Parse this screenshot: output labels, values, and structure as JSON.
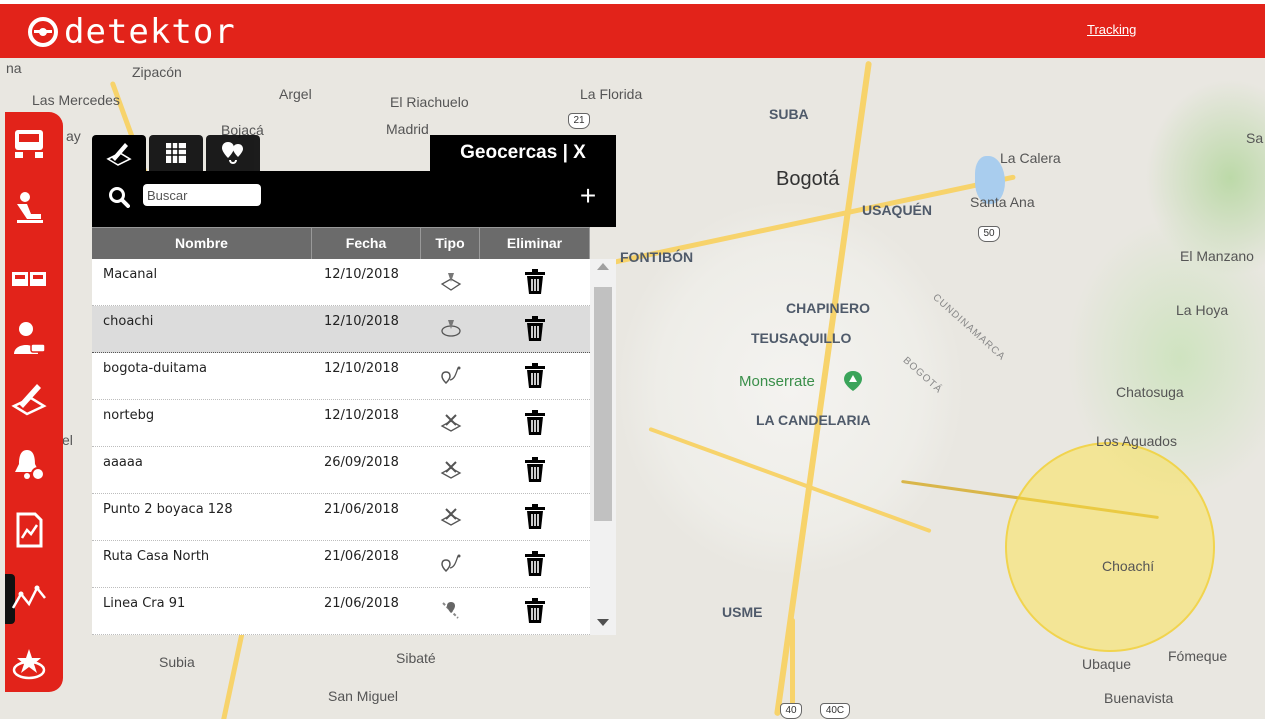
{
  "header": {
    "brand": "detektor",
    "tracking_link": "Tracking",
    "background_color": "#e2231a"
  },
  "map": {
    "labels": [
      {
        "text": "Zipacón"
      },
      {
        "text": "Las Mercedes"
      },
      {
        "text": "Argel"
      },
      {
        "text": "El Riachuelo"
      },
      {
        "text": "Madrid"
      },
      {
        "text": "Bojacá"
      },
      {
        "text": "La Florida"
      },
      {
        "text": "SUBA"
      },
      {
        "text": "Bogotá"
      },
      {
        "text": "USAQUÉN"
      },
      {
        "text": "La Calera"
      },
      {
        "text": "Santa Ana"
      },
      {
        "text": "FONTIBÓN"
      },
      {
        "text": "El Manzano"
      },
      {
        "text": "CHAPINERO"
      },
      {
        "text": "TEUSAQUILLO"
      },
      {
        "text": "La Hoya"
      },
      {
        "text": "Monserrate"
      },
      {
        "text": "LA CANDELARIA"
      },
      {
        "text": "Chatosuga"
      },
      {
        "text": "Los Aguados"
      },
      {
        "text": "Choachí"
      },
      {
        "text": "USME"
      },
      {
        "text": "Subia"
      },
      {
        "text": "Sibaté"
      },
      {
        "text": "San Miguel"
      },
      {
        "text": "Ubaque"
      },
      {
        "text": "Fómeque"
      },
      {
        "text": "Buenavista"
      },
      {
        "text": "CUNDINAMARCA"
      },
      {
        "text": "BOGOTÁ"
      },
      {
        "text": "Sa"
      },
      {
        "text": "na"
      },
      {
        "text": "ay"
      },
      {
        "text": "el"
      }
    ],
    "shields": [
      "21",
      "50",
      "40",
      "40C"
    ],
    "geofence_color": "#ffe23c"
  },
  "sidebar": {
    "items": [
      {
        "name": "truck-icon"
      },
      {
        "name": "driver-icon"
      },
      {
        "name": "fleet-icon"
      },
      {
        "name": "user-car-icon"
      },
      {
        "name": "draw-geofence-icon"
      },
      {
        "name": "alert-bell-icon"
      },
      {
        "name": "report-icon"
      },
      {
        "name": "route-icon"
      },
      {
        "name": "favorite-place-icon"
      }
    ],
    "active_index": 7
  },
  "panel": {
    "title": "Geocercas | X",
    "tabs": [
      {
        "name": "geofence-tab-icon"
      },
      {
        "name": "map-grid-tab-icon"
      },
      {
        "name": "poi-tab-icon"
      }
    ],
    "search": {
      "placeholder": "Buscar",
      "value": ""
    },
    "add_label": "+",
    "columns": [
      "Nombre",
      "Fecha",
      "Tipo",
      "Eliminar"
    ],
    "rows": [
      {
        "name": "Macanal",
        "date": "12/10/2018",
        "type": "polygon",
        "selected": false
      },
      {
        "name": "choachi",
        "date": "12/10/2018",
        "type": "circle",
        "selected": true
      },
      {
        "name": "bogota-duitama",
        "date": "12/10/2018",
        "type": "route",
        "selected": false
      },
      {
        "name": "nortebg",
        "date": "12/10/2018",
        "type": "star-area",
        "selected": false
      },
      {
        "name": "aaaaa",
        "date": "26/09/2018",
        "type": "star-area",
        "selected": false
      },
      {
        "name": "Punto 2 boyaca 128",
        "date": "21/06/2018",
        "type": "star-area",
        "selected": false
      },
      {
        "name": "Ruta Casa North",
        "date": "21/06/2018",
        "type": "route",
        "selected": false
      },
      {
        "name": "Linea Cra 91",
        "date": "21/06/2018",
        "type": "line",
        "selected": false
      }
    ]
  }
}
